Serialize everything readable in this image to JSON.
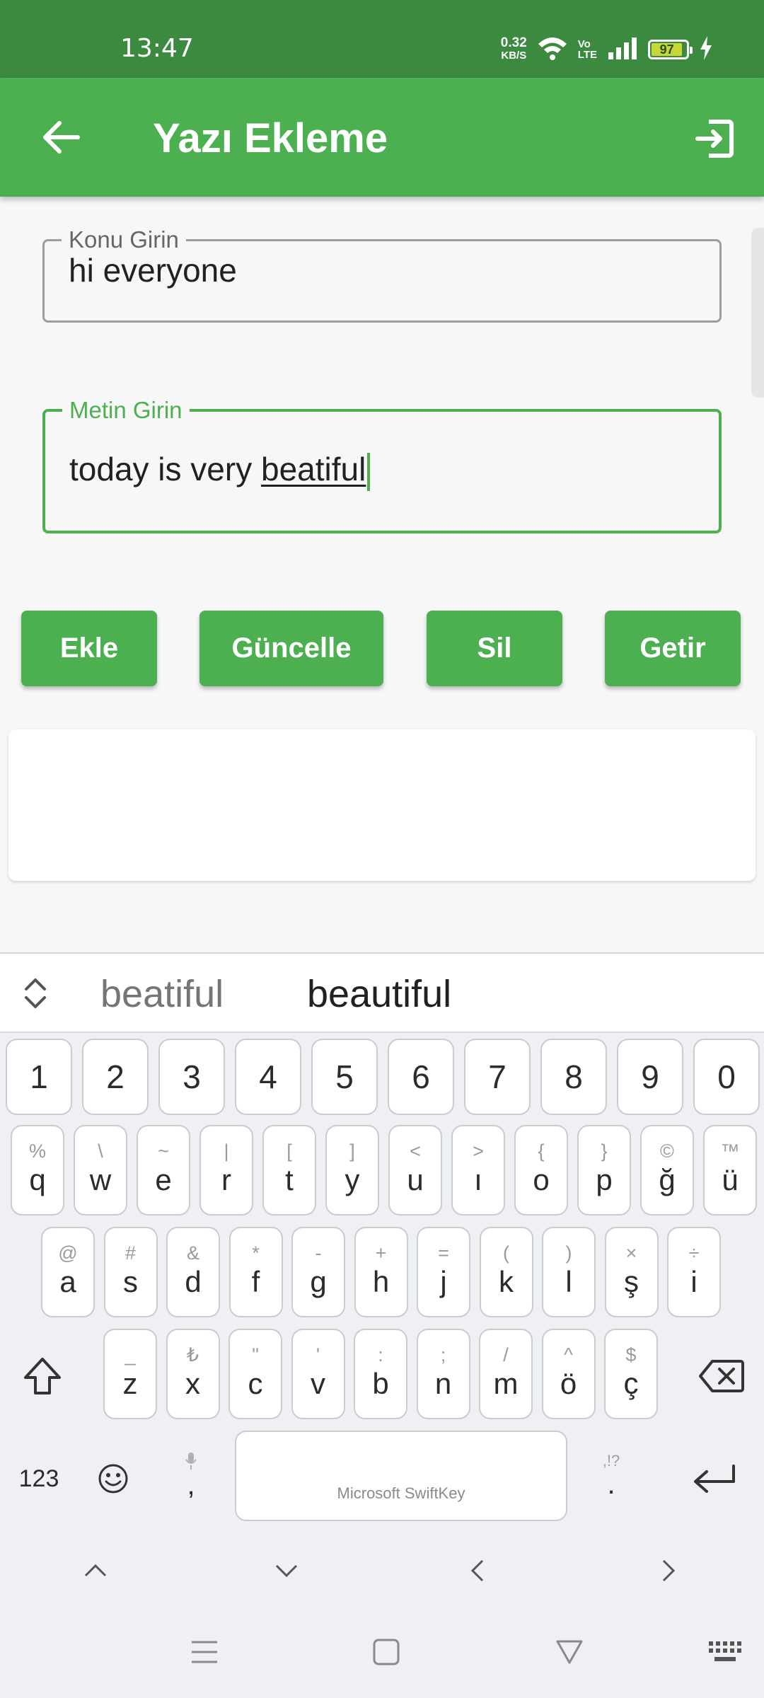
{
  "status_bar": {
    "time": "13:47",
    "net_speed_value": "0.32",
    "net_speed_unit": "KB/S",
    "volte_top": "Vo",
    "volte_bottom": "LTE",
    "battery": "97"
  },
  "app_bar": {
    "title": "Yazı Ekleme",
    "back_icon": "arrow-left-icon",
    "exit_icon": "exit-icon"
  },
  "form": {
    "subject": {
      "label": "Konu Girin",
      "value": "hi everyone"
    },
    "text": {
      "label": "Metin Girin",
      "value_prefix": "today is very ",
      "value_word": "beatiful"
    }
  },
  "buttons": {
    "ekle": "Ekle",
    "guncelle": "Güncelle",
    "sil": "Sil",
    "getir": "Getir"
  },
  "suggestions": [
    "beatiful",
    "beautiful"
  ],
  "keyboard": {
    "numbers": [
      "1",
      "2",
      "3",
      "4",
      "5",
      "6",
      "7",
      "8",
      "9",
      "0"
    ],
    "row2": [
      {
        "pri": "q",
        "sec": "%"
      },
      {
        "pri": "w",
        "sec": "\\"
      },
      {
        "pri": "e",
        "sec": "~"
      },
      {
        "pri": "r",
        "sec": "|"
      },
      {
        "pri": "t",
        "sec": "["
      },
      {
        "pri": "y",
        "sec": "]"
      },
      {
        "pri": "u",
        "sec": "<"
      },
      {
        "pri": "ı",
        "sec": ">"
      },
      {
        "pri": "o",
        "sec": "{"
      },
      {
        "pri": "p",
        "sec": "}"
      },
      {
        "pri": "ğ",
        "sec": "©"
      },
      {
        "pri": "ü",
        "sec": "™"
      }
    ],
    "row3": [
      {
        "pri": "a",
        "sec": "@"
      },
      {
        "pri": "s",
        "sec": "#"
      },
      {
        "pri": "d",
        "sec": "&"
      },
      {
        "pri": "f",
        "sec": "*"
      },
      {
        "pri": "g",
        "sec": "-"
      },
      {
        "pri": "h",
        "sec": "+"
      },
      {
        "pri": "j",
        "sec": "="
      },
      {
        "pri": "k",
        "sec": "("
      },
      {
        "pri": "l",
        "sec": ")"
      },
      {
        "pri": "ş",
        "sec": "×"
      },
      {
        "pri": "i",
        "sec": "÷"
      }
    ],
    "row4": [
      {
        "pri": "z",
        "sec": "_"
      },
      {
        "pri": "x",
        "sec": "₺"
      },
      {
        "pri": "c",
        "sec": "\""
      },
      {
        "pri": "v",
        "sec": "'"
      },
      {
        "pri": "b",
        "sec": ":"
      },
      {
        "pri": "n",
        "sec": ";"
      },
      {
        "pri": "m",
        "sec": "/"
      },
      {
        "pri": "ö",
        "sec": "^"
      },
      {
        "pri": "ç",
        "sec": "$"
      }
    ],
    "symbols_key": "123",
    "comma_key": ",",
    "period_key": ".",
    "period_hint": ",!?",
    "space_label": "Microsoft SwiftKey"
  }
}
